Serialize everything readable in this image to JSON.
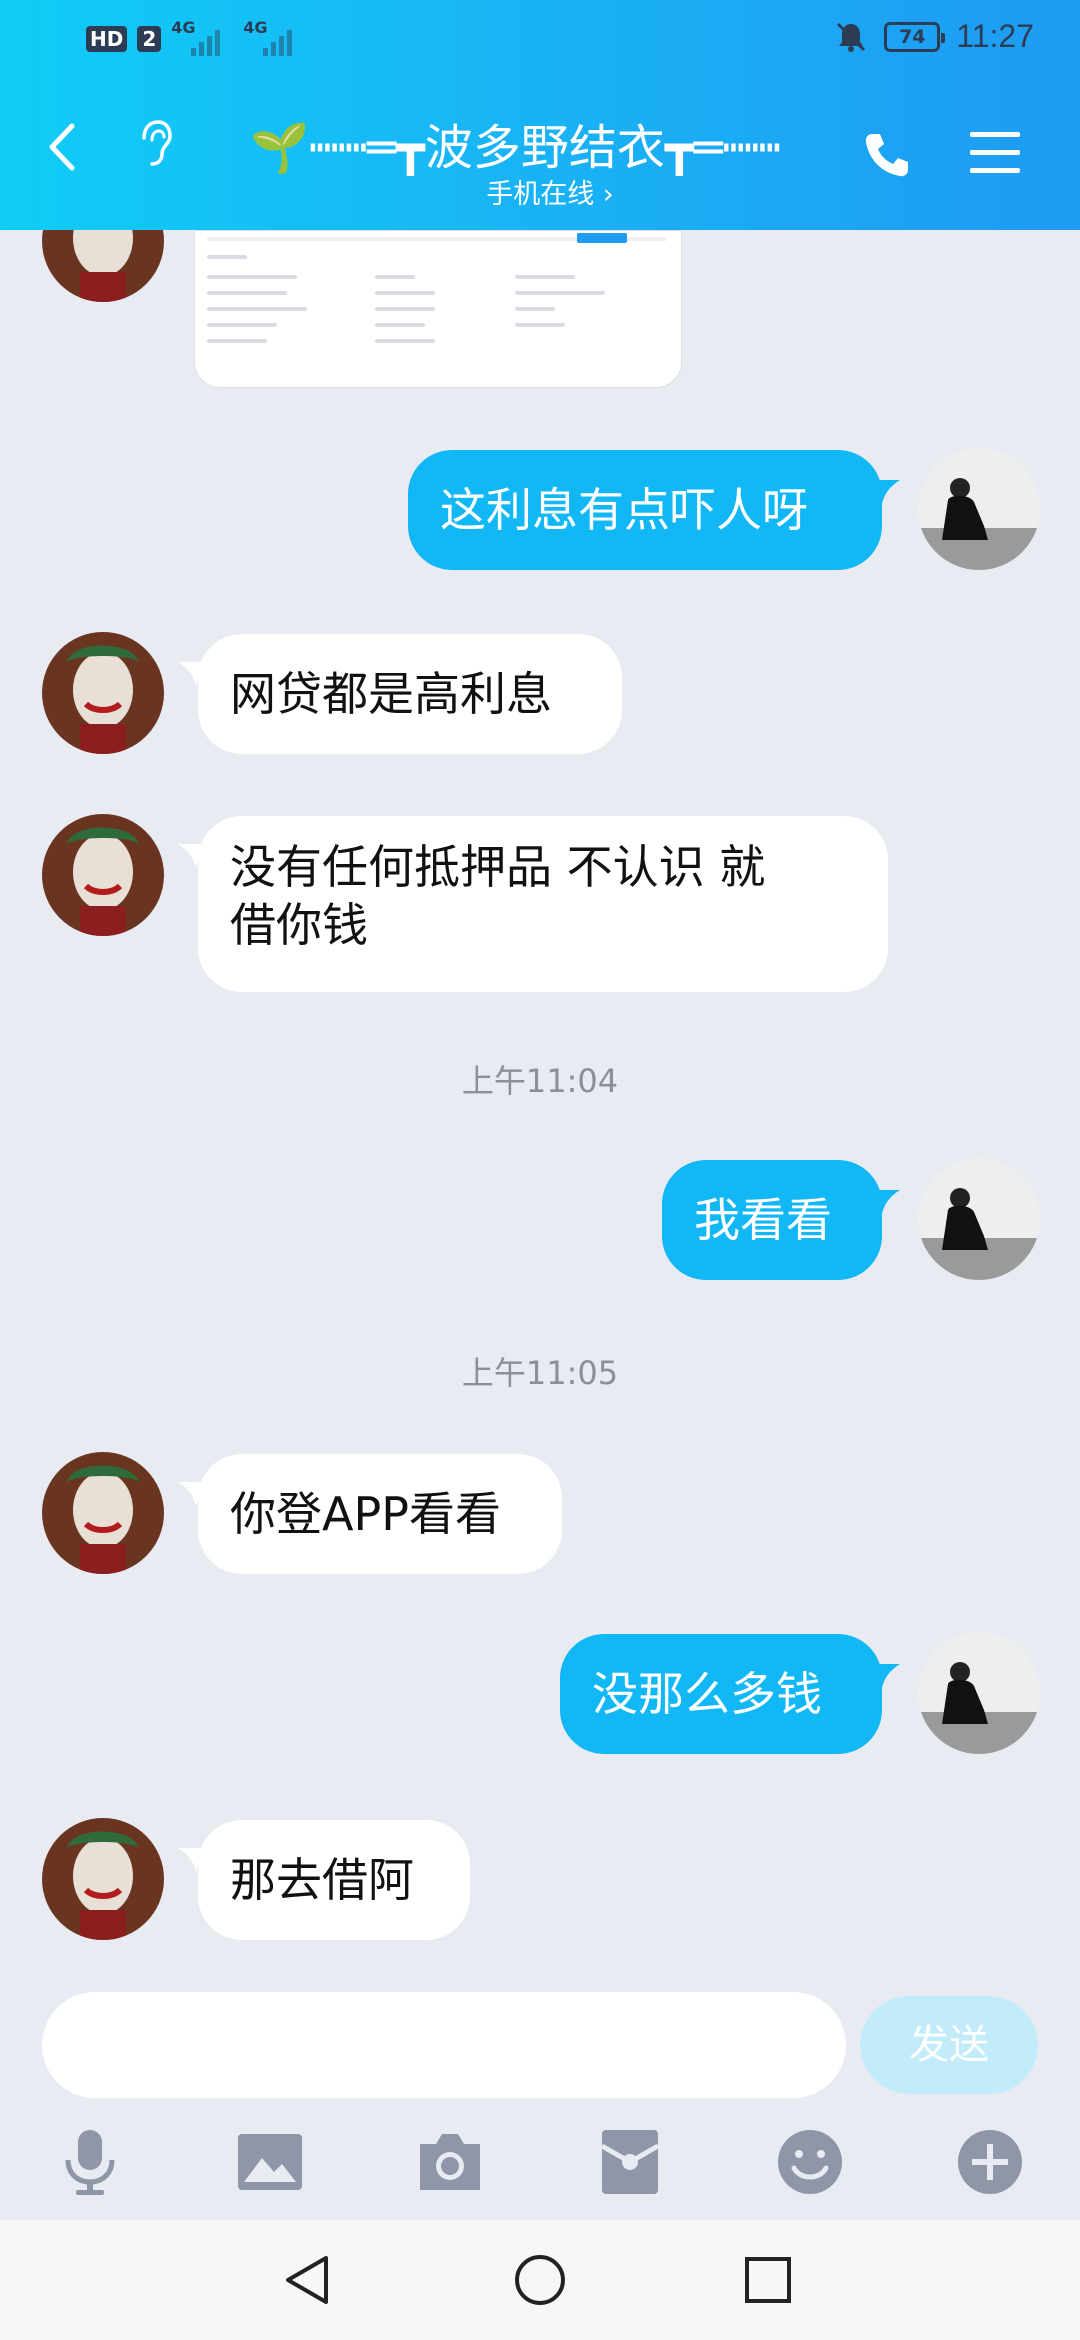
{
  "status_bar": {
    "hd": "HD",
    "sim": "2",
    "net1": "4G",
    "net2": "4G",
    "battery": "74",
    "time": "11:27"
  },
  "header": {
    "title": "🌱┉┉═┳波多野结衣┳═┉┉",
    "subtitle": "手机在线 ›"
  },
  "messages": [
    {
      "type": "out",
      "text": "这利息有点吓人呀"
    },
    {
      "type": "in",
      "text": "网贷都是高利息"
    },
    {
      "type": "in",
      "line1": "没有任何抵押品 不认识 就",
      "line2": "借你钱"
    },
    {
      "type": "time",
      "text": "上午11:04"
    },
    {
      "type": "out",
      "text": "我看看"
    },
    {
      "type": "time",
      "text": "上午11:05"
    },
    {
      "type": "in",
      "text": "你登APP看看"
    },
    {
      "type": "out",
      "text": "没那么多钱"
    },
    {
      "type": "in",
      "text": "那去借阿"
    }
  ],
  "input": {
    "placeholder": "",
    "send_label": "发送"
  },
  "colors": {
    "header_start": "#10ccf6",
    "header_end": "#1e9bf2",
    "bubble_out": "#12b7f5",
    "bubble_in": "#ffffff",
    "background": "#e9ebf2",
    "send_disabled": "#c3ecfb"
  },
  "icons": [
    "back-icon",
    "ear-icon",
    "phone-icon",
    "menu-icon",
    "mic-icon",
    "image-icon",
    "camera-icon",
    "red-packet-icon",
    "emoji-icon",
    "plus-icon",
    "nav-back-icon",
    "nav-home-icon",
    "nav-recents-icon"
  ]
}
